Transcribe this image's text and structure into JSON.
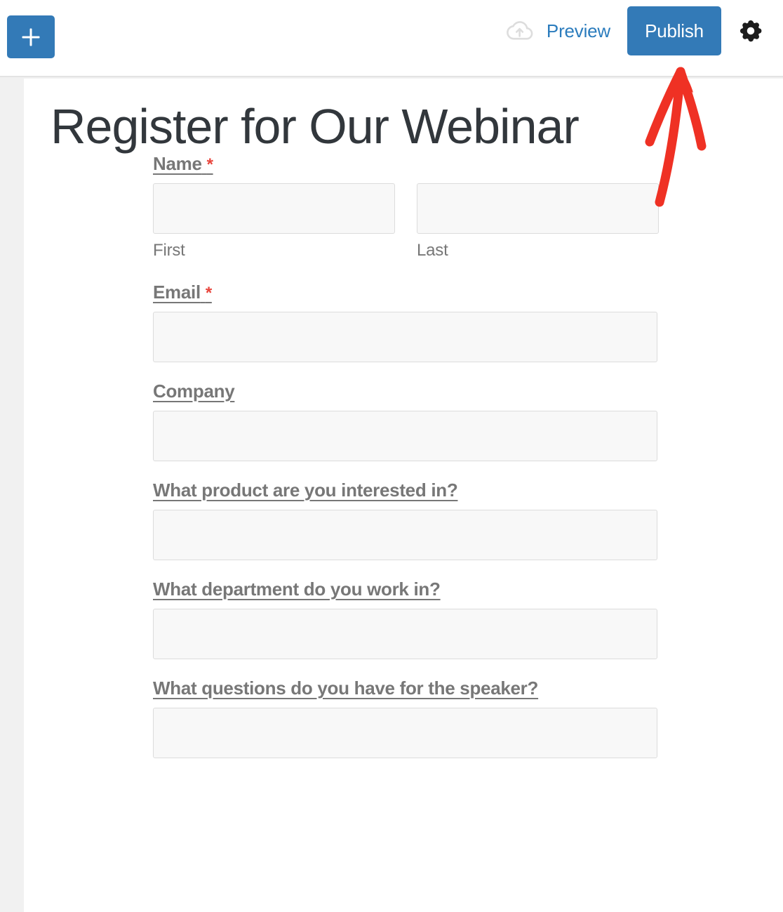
{
  "toolbar": {
    "add_block_label": "+",
    "add_block_icon": "plus-icon",
    "save_draft_icon": "cloud-upload-icon",
    "preview_label": "Preview",
    "publish_label": "Publish",
    "settings_icon": "gear-icon"
  },
  "annotation": {
    "arrow_icon": "red-arrow-up-icon",
    "color": "#ef3124"
  },
  "form": {
    "title": "Register for Our Webinar",
    "fields": [
      {
        "label": "Name",
        "required": true,
        "required_marker": "*",
        "type": "name",
        "value": "",
        "placeholder": "",
        "sub_fields": [
          {
            "sub_label": "First",
            "value": "",
            "placeholder": ""
          },
          {
            "sub_label": "Last",
            "value": "",
            "placeholder": ""
          }
        ]
      },
      {
        "label": "Email",
        "required": true,
        "required_marker": "*",
        "type": "email",
        "value": "",
        "placeholder": ""
      },
      {
        "label": "Company",
        "required": false,
        "required_marker": "",
        "type": "text",
        "value": "",
        "placeholder": ""
      },
      {
        "label": "What product are you interested in?",
        "required": false,
        "required_marker": "",
        "type": "text",
        "value": "",
        "placeholder": ""
      },
      {
        "label": "What department do you work in?",
        "required": false,
        "required_marker": "",
        "type": "text",
        "value": "",
        "placeholder": ""
      },
      {
        "label": "What questions do you have for the speaker?",
        "required": false,
        "required_marker": "",
        "type": "text",
        "value": "",
        "placeholder": ""
      }
    ]
  },
  "colors": {
    "accent_blue": "#337ab7",
    "link_blue": "#2b7cbd",
    "label_gray": "#777777",
    "required_red": "#e8453c",
    "annotation_red": "#ef3124",
    "input_bg": "#f8f8f8",
    "input_border": "#dcdcdc",
    "canvas_bg": "#f1f1f1"
  }
}
